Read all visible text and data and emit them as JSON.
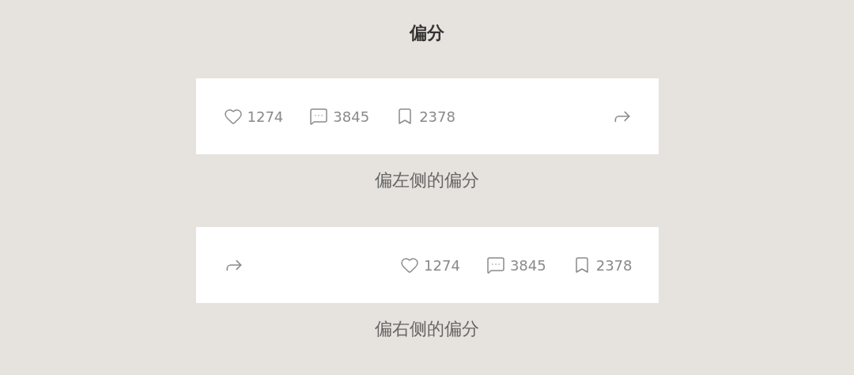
{
  "title": "偏分",
  "cards": [
    {
      "share_first": false,
      "stats": [
        {
          "kind": "like",
          "count": "1274"
        },
        {
          "kind": "comment",
          "count": "3845"
        },
        {
          "kind": "bookmark",
          "count": "2378"
        }
      ],
      "caption": "偏左侧的偏分"
    },
    {
      "share_first": true,
      "stats": [
        {
          "kind": "like",
          "count": "1274"
        },
        {
          "kind": "comment",
          "count": "3845"
        },
        {
          "kind": "bookmark",
          "count": "2378"
        }
      ],
      "caption": "偏右侧的偏分"
    }
  ]
}
